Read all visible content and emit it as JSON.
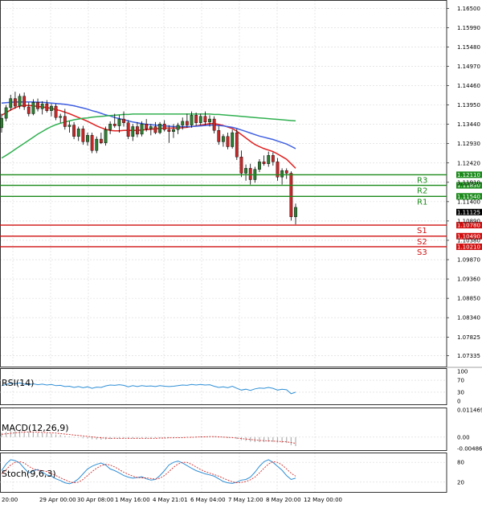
{
  "colors": {
    "grid": "#d8d8d8",
    "frame": "#000000",
    "bull": "#2e7d32",
    "bear": "#c62828",
    "ma_red": "#e02020",
    "ma_blue": "#4060e0",
    "ma_green": "#30b050",
    "resistance": "#1b8a1b",
    "support": "#d01010",
    "rsi_line": "#2f8fd6",
    "macd_hist": "#b0b0b0",
    "macd_signal": "#d03030",
    "stoch_main": "#2f8fd6",
    "stoch_signal": "#d03030"
  },
  "chart_data": [
    {
      "type": "candlestick",
      "pane": "price",
      "y_ticks": [
        "1.16500",
        "1.15990",
        "1.15480",
        "1.14970",
        "1.14460",
        "1.13950",
        "1.13440",
        "1.12930",
        "1.12420",
        "1.11910",
        "1.11400",
        "1.10890",
        "1.10380",
        "1.09870",
        "1.09360",
        "1.08850",
        "1.08340",
        "1.07825",
        "1.07335"
      ],
      "ylim": [
        1.0705,
        1.1672
      ],
      "x_labels": [
        "20:00",
        "29 Apr 00:00",
        "30 Apr 08:00",
        "1 May 16:00",
        "4 May 21:01",
        "6 May 04:00",
        "7 May 12:00",
        "8 May 20:00",
        "12 May 00:00"
      ],
      "candles": [
        {
          "o": 1.1335,
          "h": 1.1372,
          "l": 1.1322,
          "c": 1.136
        },
        {
          "o": 1.136,
          "h": 1.1395,
          "l": 1.1352,
          "c": 1.1388
        },
        {
          "o": 1.1388,
          "h": 1.1422,
          "l": 1.138,
          "c": 1.1412
        },
        {
          "o": 1.1412,
          "h": 1.143,
          "l": 1.1385,
          "c": 1.1392
        },
        {
          "o": 1.1392,
          "h": 1.1425,
          "l": 1.1385,
          "c": 1.1418
        },
        {
          "o": 1.1418,
          "h": 1.1428,
          "l": 1.1382,
          "c": 1.139
        },
        {
          "o": 1.139,
          "h": 1.1402,
          "l": 1.1365,
          "c": 1.1372
        },
        {
          "o": 1.1372,
          "h": 1.141,
          "l": 1.1368,
          "c": 1.1402
        },
        {
          "o": 1.1402,
          "h": 1.1412,
          "l": 1.1378,
          "c": 1.1385
        },
        {
          "o": 1.1385,
          "h": 1.1405,
          "l": 1.137,
          "c": 1.1398
        },
        {
          "o": 1.1398,
          "h": 1.1408,
          "l": 1.1375,
          "c": 1.138
        },
        {
          "o": 1.138,
          "h": 1.1398,
          "l": 1.1365,
          "c": 1.1392
        },
        {
          "o": 1.1392,
          "h": 1.1398,
          "l": 1.1355,
          "c": 1.1362
        },
        {
          "o": 1.1362,
          "h": 1.1372,
          "l": 1.1348,
          "c": 1.1365
        },
        {
          "o": 1.1365,
          "h": 1.1385,
          "l": 1.133,
          "c": 1.1338
        },
        {
          "o": 1.1338,
          "h": 1.1352,
          "l": 1.1322,
          "c": 1.1342
        },
        {
          "o": 1.1342,
          "h": 1.135,
          "l": 1.1305,
          "c": 1.1312
        },
        {
          "o": 1.1312,
          "h": 1.1338,
          "l": 1.13,
          "c": 1.1332
        },
        {
          "o": 1.1332,
          "h": 1.134,
          "l": 1.129,
          "c": 1.1298
        },
        {
          "o": 1.1298,
          "h": 1.1322,
          "l": 1.1288,
          "c": 1.1315
        },
        {
          "o": 1.1315,
          "h": 1.1322,
          "l": 1.1268,
          "c": 1.1275
        },
        {
          "o": 1.1275,
          "h": 1.1312,
          "l": 1.1268,
          "c": 1.1305
        },
        {
          "o": 1.1305,
          "h": 1.1322,
          "l": 1.1292,
          "c": 1.1295
        },
        {
          "o": 1.1295,
          "h": 1.1338,
          "l": 1.1288,
          "c": 1.133
        },
        {
          "o": 1.133,
          "h": 1.1352,
          "l": 1.1318,
          "c": 1.1345
        },
        {
          "o": 1.1345,
          "h": 1.1372,
          "l": 1.1335,
          "c": 1.134
        },
        {
          "o": 1.134,
          "h": 1.1368,
          "l": 1.1322,
          "c": 1.1358
        },
        {
          "o": 1.1358,
          "h": 1.1378,
          "l": 1.1338,
          "c": 1.1348
        },
        {
          "o": 1.1348,
          "h": 1.1355,
          "l": 1.1305,
          "c": 1.1312
        },
        {
          "o": 1.1312,
          "h": 1.1345,
          "l": 1.13,
          "c": 1.1338
        },
        {
          "o": 1.1338,
          "h": 1.135,
          "l": 1.131,
          "c": 1.1318
        },
        {
          "o": 1.1318,
          "h": 1.1352,
          "l": 1.1312,
          "c": 1.1345
        },
        {
          "o": 1.1345,
          "h": 1.1358,
          "l": 1.1325,
          "c": 1.1332
        },
        {
          "o": 1.1332,
          "h": 1.1345,
          "l": 1.1315,
          "c": 1.1338
        },
        {
          "o": 1.1338,
          "h": 1.135,
          "l": 1.1318,
          "c": 1.1322
        },
        {
          "o": 1.1322,
          "h": 1.135,
          "l": 1.1318,
          "c": 1.1345
        },
        {
          "o": 1.1345,
          "h": 1.1355,
          "l": 1.1325,
          "c": 1.133
        },
        {
          "o": 1.133,
          "h": 1.1342,
          "l": 1.1295,
          "c": 1.1325
        },
        {
          "o": 1.1325,
          "h": 1.1345,
          "l": 1.1308,
          "c": 1.133
        },
        {
          "o": 1.133,
          "h": 1.1348,
          "l": 1.1318,
          "c": 1.1342
        },
        {
          "o": 1.1342,
          "h": 1.1362,
          "l": 1.133,
          "c": 1.1352
        },
        {
          "o": 1.1352,
          "h": 1.1372,
          "l": 1.1335,
          "c": 1.1342
        },
        {
          "o": 1.1342,
          "h": 1.1378,
          "l": 1.1335,
          "c": 1.1368
        },
        {
          "o": 1.1368,
          "h": 1.1375,
          "l": 1.134,
          "c": 1.1348
        },
        {
          "o": 1.1348,
          "h": 1.1372,
          "l": 1.1342,
          "c": 1.1365
        },
        {
          "o": 1.1365,
          "h": 1.1378,
          "l": 1.1342,
          "c": 1.135
        },
        {
          "o": 1.135,
          "h": 1.1368,
          "l": 1.1338,
          "c": 1.1358
        },
        {
          "o": 1.1358,
          "h": 1.1365,
          "l": 1.132,
          "c": 1.1328
        },
        {
          "o": 1.1328,
          "h": 1.134,
          "l": 1.129,
          "c": 1.1298
        },
        {
          "o": 1.1298,
          "h": 1.1318,
          "l": 1.1285,
          "c": 1.1312
        },
        {
          "o": 1.1312,
          "h": 1.1322,
          "l": 1.1278,
          "c": 1.1285
        },
        {
          "o": 1.1285,
          "h": 1.133,
          "l": 1.128,
          "c": 1.1322
        },
        {
          "o": 1.1322,
          "h": 1.1332,
          "l": 1.125,
          "c": 1.1258
        },
        {
          "o": 1.1258,
          "h": 1.1275,
          "l": 1.1205,
          "c": 1.1215
        },
        {
          "o": 1.1215,
          "h": 1.1238,
          "l": 1.1195,
          "c": 1.1228
        },
        {
          "o": 1.1228,
          "h": 1.124,
          "l": 1.1185,
          "c": 1.1198
        },
        {
          "o": 1.1198,
          "h": 1.1232,
          "l": 1.119,
          "c": 1.1225
        },
        {
          "o": 1.1225,
          "h": 1.1252,
          "l": 1.1218,
          "c": 1.1245
        },
        {
          "o": 1.1245,
          "h": 1.1262,
          "l": 1.1235,
          "c": 1.124
        },
        {
          "o": 1.124,
          "h": 1.1272,
          "l": 1.1232,
          "c": 1.1262
        },
        {
          "o": 1.1262,
          "h": 1.127,
          "l": 1.1235,
          "c": 1.1245
        },
        {
          "o": 1.1245,
          "h": 1.1255,
          "l": 1.1195,
          "c": 1.1205
        },
        {
          "o": 1.1205,
          "h": 1.1228,
          "l": 1.1185,
          "c": 1.1222
        },
        {
          "o": 1.1222,
          "h": 1.1228,
          "l": 1.12,
          "c": 1.1215
        },
        {
          "o": 1.1215,
          "h": 1.122,
          "l": 1.109,
          "c": 1.11
        },
        {
          "o": 1.11,
          "h": 1.1135,
          "l": 1.108,
          "c": 1.1125
        }
      ],
      "moving_averages": [
        {
          "color_key": "ma_red",
          "values": [
            1.1368,
            1.1375,
            1.1382,
            1.1388,
            1.1392,
            1.1394,
            1.1394,
            1.1393,
            1.1391,
            1.139,
            1.1388,
            1.1386,
            1.1383,
            1.138,
            1.1376,
            1.1372,
            1.1367,
            1.1362,
            1.1357,
            1.1352,
            1.1346,
            1.134,
            1.1335,
            1.1331,
            1.1328,
            1.1327,
            1.1327,
            1.1328,
            1.1328,
            1.1328,
            1.1328,
            1.1329,
            1.133,
            1.1331,
            1.1332,
            1.1333,
            1.1334,
            1.1334,
            1.1334,
            1.1334,
            1.1335,
            1.1336,
            1.1338,
            1.134,
            1.1342,
            1.1344,
            1.1346,
            1.1346,
            1.1344,
            1.1341,
            1.1337,
            1.1333,
            1.1326,
            1.1317,
            1.1308,
            1.1299,
            1.1291,
            1.1285,
            1.128,
            1.1276,
            1.1272,
            1.1266,
            1.1259,
            1.1252,
            1.124,
            1.1228
          ]
        },
        {
          "color_key": "ma_blue",
          "values": [
            1.14,
            1.1401,
            1.1402,
            1.1403,
            1.1403,
            1.1403,
            1.1403,
            1.1403,
            1.1402,
            1.1402,
            1.1401,
            1.14,
            1.1399,
            1.1398,
            1.1397,
            1.1395,
            1.1393,
            1.139,
            1.1387,
            1.1384,
            1.138,
            1.1377,
            1.1373,
            1.1369,
            1.1366,
            1.1362,
            1.1359,
            1.1356,
            1.1353,
            1.135,
            1.1348,
            1.1346,
            1.1344,
            1.1343,
            1.1342,
            1.1341,
            1.134,
            1.1339,
            1.1338,
            1.1338,
            1.1338,
            1.1338,
            1.1338,
            1.1339,
            1.134,
            1.1341,
            1.1342,
            1.1342,
            1.1341,
            1.134,
            1.1338,
            1.1336,
            1.1333,
            1.1329,
            1.1325,
            1.1321,
            1.1317,
            1.1313,
            1.131,
            1.1307,
            1.1304,
            1.13,
            1.1296,
            1.1292,
            1.1286,
            1.128
          ]
        },
        {
          "color_key": "ma_green",
          "values": [
            1.1255,
            1.1262,
            1.127,
            1.1278,
            1.1286,
            1.1294,
            1.1302,
            1.131,
            1.1318,
            1.1325,
            1.1332,
            1.1338,
            1.1343,
            1.1347,
            1.135,
            1.1353,
            1.1356,
            1.1358,
            1.136,
            1.1361,
            1.1363,
            1.1364,
            1.1365,
            1.1366,
            1.1367,
            1.1368,
            1.1369,
            1.137,
            1.137,
            1.1371,
            1.1371,
            1.1371,
            1.1371,
            1.1371,
            1.1371,
            1.1371,
            1.1371,
            1.1371,
            1.1371,
            1.1371,
            1.1371,
            1.1371,
            1.1371,
            1.1371,
            1.1371,
            1.1371,
            1.1371,
            1.137,
            1.137,
            1.1369,
            1.1368,
            1.1367,
            1.1366,
            1.1365,
            1.1364,
            1.1363,
            1.1362,
            1.1361,
            1.136,
            1.1359,
            1.1358,
            1.1357,
            1.1356,
            1.1355,
            1.1354,
            1.1353
          ]
        }
      ],
      "levels": [
        {
          "label": "R3",
          "price": 1.1211,
          "price_label": "1.12110",
          "kind": "resistance"
        },
        {
          "label": "R2",
          "price": 1.1183,
          "price_label": "1.11830",
          "kind": "resistance"
        },
        {
          "label": "R1",
          "price": 1.1154,
          "price_label": "1.11540",
          "kind": "resistance"
        },
        {
          "label": "S1",
          "price": 1.1078,
          "price_label": "1.10780",
          "kind": "support"
        },
        {
          "label": "S2",
          "price": 1.1049,
          "price_label": "1.10490",
          "kind": "support"
        },
        {
          "label": "S3",
          "price": 1.1021,
          "price_label": "1.10210",
          "kind": "support"
        }
      ],
      "current_price": 1.11125,
      "current_price_label": "1.11125"
    },
    {
      "type": "line",
      "pane": "rsi",
      "title": "RSI(14)",
      "ylim": [
        0,
        100
      ],
      "y_ticks": [
        "100",
        "70",
        "30",
        "0"
      ],
      "values": [
        52,
        56,
        60,
        58,
        61,
        57,
        55,
        58,
        55,
        57,
        54,
        56,
        52,
        53,
        49,
        50,
        46,
        49,
        45,
        48,
        43,
        47,
        46,
        51,
        54,
        53,
        55,
        53,
        48,
        52,
        49,
        52,
        50,
        51,
        49,
        52,
        50,
        49,
        50,
        52,
        54,
        53,
        56,
        54,
        56,
        54,
        55,
        50,
        46,
        48,
        45,
        50,
        43,
        37,
        40,
        36,
        41,
        44,
        43,
        46,
        43,
        37,
        40,
        38,
        25,
        30
      ]
    },
    {
      "type": "bar",
      "pane": "macd",
      "title": "MACD(12,26,9)",
      "ylim": [
        -0.0055,
        0.0125
      ],
      "y_ticks": [
        "0.011469",
        "0.00",
        "-0.004862"
      ],
      "values": [
        0.0018,
        0.0022,
        0.0026,
        0.0026,
        0.0027,
        0.0025,
        0.0022,
        0.0021,
        0.0019,
        0.0018,
        0.0016,
        0.0015,
        0.0011,
        0.0009,
        0.0005,
        0.0003,
        -0.0001,
        -0.0002,
        -0.0005,
        -0.0006,
        -0.0009,
        -0.001,
        -0.0011,
        -0.001,
        -0.0008,
        -0.0007,
        -0.0006,
        -0.0005,
        -0.0006,
        -0.0005,
        -0.0006,
        -0.0005,
        -0.0005,
        -0.0004,
        -0.0004,
        -0.0003,
        -0.0003,
        -0.0003,
        -0.0002,
        -0.0001,
        0.0,
        0.0001,
        0.0002,
        0.0002,
        0.0003,
        0.0003,
        0.0003,
        0.0001,
        -0.0001,
        -0.0002,
        -0.0004,
        -0.0004,
        -0.0008,
        -0.0013,
        -0.0016,
        -0.0019,
        -0.0021,
        -0.0021,
        -0.0021,
        -0.002,
        -0.002,
        -0.0023,
        -0.0024,
        -0.0025,
        -0.0034,
        -0.0038
      ],
      "signal": [
        0.0012,
        0.0014,
        0.0016,
        0.0018,
        0.002,
        0.0021,
        0.0021,
        0.0021,
        0.0021,
        0.002,
        0.0019,
        0.0018,
        0.0017,
        0.0015,
        0.0013,
        0.0011,
        0.0009,
        0.0007,
        0.0005,
        0.0003,
        0.0001,
        -0.0001,
        -0.0003,
        -0.0004,
        -0.0005,
        -0.0005,
        -0.0005,
        -0.0005,
        -0.0005,
        -0.0005,
        -0.0005,
        -0.0005,
        -0.0005,
        -0.0005,
        -0.0005,
        -0.0004,
        -0.0004,
        -0.0003,
        -0.0003,
        -0.0002,
        -0.0002,
        -0.0001,
        -0.0001,
        0.0,
        0.0001,
        0.0001,
        0.0002,
        0.0002,
        0.0001,
        0.0,
        -0.0001,
        -0.0002,
        -0.0004,
        -0.0006,
        -0.0008,
        -0.001,
        -0.0012,
        -0.0014,
        -0.0015,
        -0.0016,
        -0.0017,
        -0.0018,
        -0.0019,
        -0.002,
        -0.0023,
        -0.0026
      ]
    },
    {
      "type": "line",
      "pane": "stoch",
      "title": "Stoch(9,6,3)",
      "ylim": [
        0,
        100
      ],
      "y_ticks": [
        "80",
        "20"
      ],
      "main": [
        55,
        75,
        88,
        85,
        78,
        62,
        48,
        55,
        58,
        50,
        42,
        38,
        30,
        25,
        18,
        15,
        20,
        30,
        45,
        60,
        68,
        74,
        78,
        72,
        60,
        55,
        48,
        40,
        35,
        32,
        34,
        36,
        30,
        26,
        28,
        40,
        55,
        72,
        80,
        84,
        78,
        70,
        62,
        55,
        50,
        45,
        42,
        38,
        30,
        22,
        18,
        16,
        20,
        26,
        28,
        35,
        50,
        68,
        82,
        88,
        80,
        68,
        56,
        40,
        28,
        32
      ],
      "signal": [
        45,
        58,
        72,
        80,
        82,
        78,
        68,
        60,
        56,
        55,
        52,
        46,
        40,
        33,
        27,
        21,
        18,
        20,
        28,
        40,
        52,
        62,
        70,
        74,
        72,
        66,
        58,
        50,
        44,
        38,
        34,
        33,
        33,
        31,
        29,
        32,
        40,
        52,
        65,
        75,
        80,
        80,
        74,
        66,
        58,
        52,
        47,
        43,
        38,
        32,
        26,
        21,
        18,
        19,
        22,
        27,
        35,
        48,
        62,
        75,
        82,
        80,
        72,
        60,
        47,
        38
      ]
    }
  ]
}
